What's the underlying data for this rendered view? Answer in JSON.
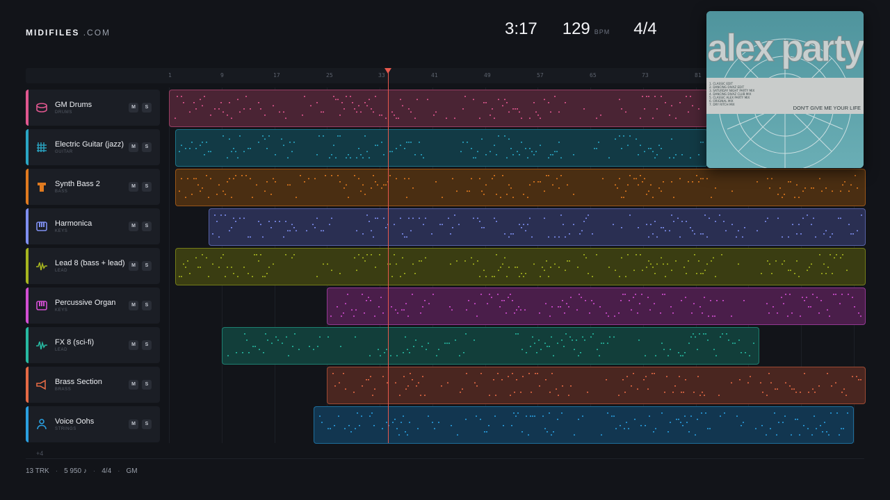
{
  "header": {
    "logo_bold": "MIDIFILES",
    "logo_rest": ".COM",
    "duration": "3:17",
    "bpm": "129",
    "bpm_unit": "BPM",
    "time_signature": "4/4"
  },
  "album": {
    "artist": "alex party",
    "title": "DON'T GIVE ME YOUR LIFE",
    "tracklist": [
      "1. CLASSIC EDIT",
      "2. DANCING DIVAZ EDIT",
      "3. SATURDAY NIGHT PARTY MIX",
      "4. DANCING DIVAZ CLUB MIX",
      "5. CLASSIC ALEX PARTY MIX",
      "6. ORIGINAL MIX",
      "7. DRY RITCH MIX"
    ]
  },
  "ruler": {
    "ticks": [
      "1",
      "9",
      "17",
      "25",
      "33",
      "41",
      "49",
      "57",
      "65",
      "73",
      "81"
    ]
  },
  "tracks": [
    {
      "name": "GM Drums",
      "category": "DRUMS",
      "icon": "drum-icon",
      "color": "#e0578f",
      "bg": "#4a2434",
      "start": 1
    },
    {
      "name": "Electric Guitar (jazz)",
      "category": "GUITAR",
      "icon": "guitar-icon",
      "color": "#2aa6c4",
      "bg": "#123a45",
      "start": 2
    },
    {
      "name": "Synth Bass 2",
      "category": "BASS",
      "icon": "bass-icon",
      "color": "#e07a1f",
      "bg": "#4a2e12",
      "start": 2
    },
    {
      "name": "Harmonica",
      "category": "KEYS",
      "icon": "keys-icon",
      "color": "#7f8ff0",
      "bg": "#2a2f52",
      "start": 7
    },
    {
      "name": "Lead 8 (bass + lead)",
      "category": "LEAD",
      "icon": "wave-icon",
      "color": "#a6b51f",
      "bg": "#3a3d12",
      "start": 2
    },
    {
      "name": "Percussive Organ",
      "category": "KEYS",
      "icon": "keys-icon",
      "color": "#d24fd2",
      "bg": "#4a1e4a",
      "start": 25
    },
    {
      "name": "FX 8 (sci-fi)",
      "category": "LEAD",
      "icon": "wave-icon",
      "color": "#27b9a1",
      "bg": "#123e3a",
      "start": 9
    },
    {
      "name": "Brass Section",
      "category": "BRASS",
      "icon": "brass-icon",
      "color": "#e56a45",
      "bg": "#4a2620",
      "start": 25
    },
    {
      "name": "Voice Oohs",
      "category": "STRINGS",
      "icon": "voice-icon",
      "color": "#2a9fe0",
      "bg": "#123650",
      "start": 23
    }
  ],
  "more_tracks": "+4",
  "footer": {
    "tracks": "13 TRK",
    "notes": "5 950 ♪",
    "time_signature": "4/4",
    "format": "GM"
  },
  "buttons": {
    "mute": "M",
    "solo": "S"
  },
  "playhead_bar": 33
}
